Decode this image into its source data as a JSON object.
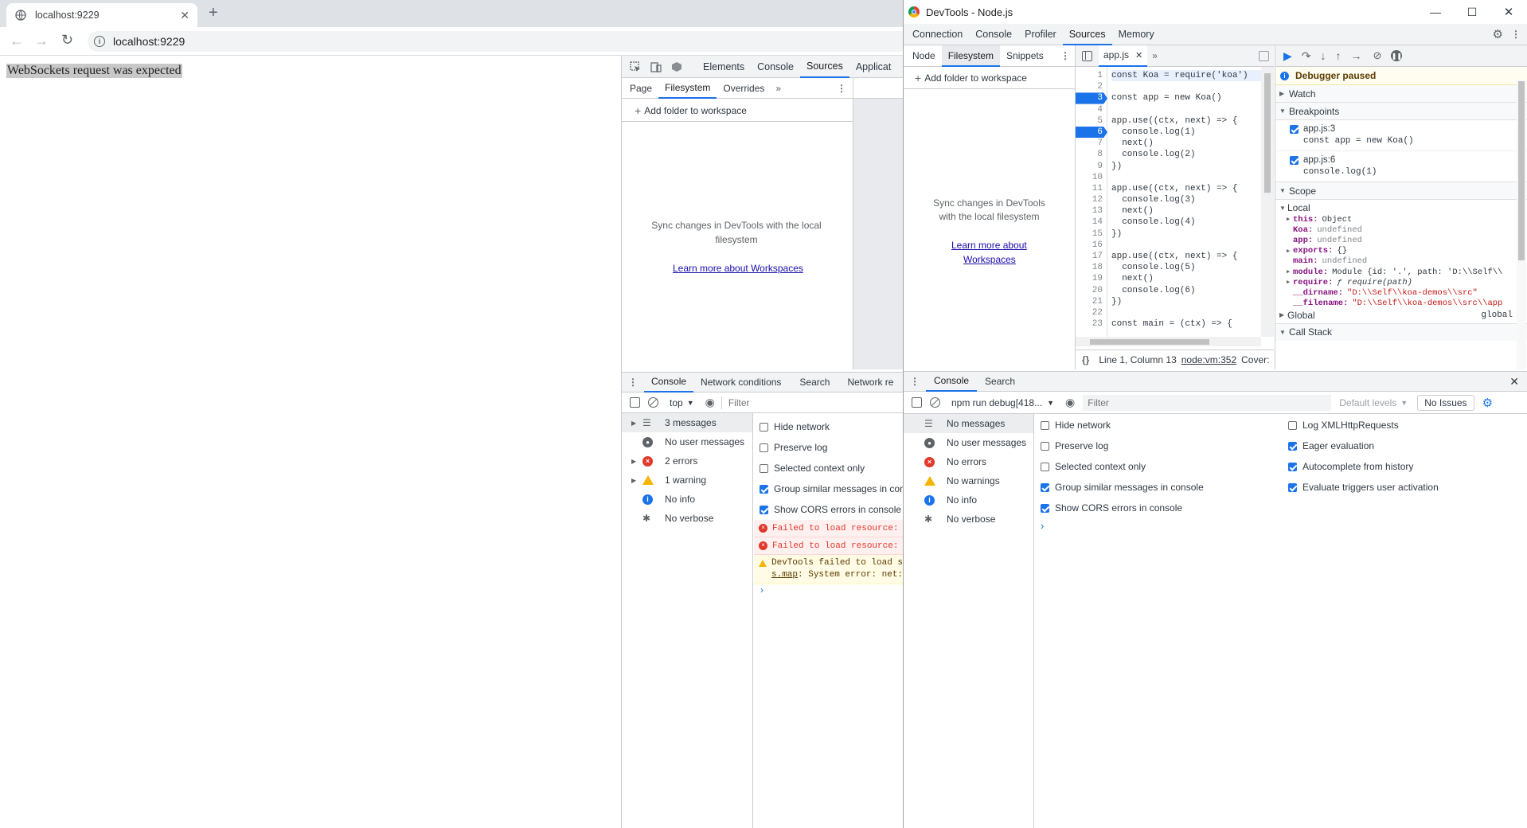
{
  "browser": {
    "tab_title": "localhost:9229",
    "url": "localhost:9229",
    "page_text": "WebSockets request was expected"
  },
  "inpage_devtools": {
    "main_tabs": [
      "Elements",
      "Console",
      "Sources",
      "Applicat"
    ],
    "nav_tabs": [
      "Page",
      "Filesystem",
      "Overrides"
    ],
    "add_folder": "Add folder to workspace",
    "sync_text": "Sync changes in DevTools with the local filesystem",
    "learn_more": "Learn more about Workspaces",
    "drawer_tabs": [
      "Console",
      "Network conditions",
      "Search",
      "Network re"
    ],
    "context": "top",
    "filter_placeholder": "Filter",
    "sidebar": [
      {
        "label": "3 messages",
        "icon": "list-icon",
        "arrow": true
      },
      {
        "label": "No user messages",
        "icon": "user-icon",
        "arrow": false
      },
      {
        "label": "2 errors",
        "icon": "error-icon",
        "arrow": true
      },
      {
        "label": "1 warning",
        "icon": "warning-icon",
        "arrow": true
      },
      {
        "label": "No info",
        "icon": "info-icon",
        "arrow": false
      },
      {
        "label": "No verbose",
        "icon": "verbose-icon",
        "arrow": false
      }
    ],
    "settings": [
      {
        "label": "Hide network",
        "checked": false
      },
      {
        "label": "Preserve log",
        "checked": false
      },
      {
        "label": "Selected context only",
        "checked": false
      },
      {
        "label": "Group similar messages in con",
        "checked": true
      },
      {
        "label": "Show CORS errors in console",
        "checked": true
      }
    ],
    "messages": [
      {
        "type": "error",
        "text": "Failed to load resource:"
      },
      {
        "type": "error",
        "text": "Failed to load resource:"
      },
      {
        "type": "warning",
        "text": "DevTools failed to load s",
        "text2_link": "s.map",
        "text2": ": System error: net:"
      }
    ]
  },
  "node_devtools": {
    "title": "DevTools - Node.js",
    "top_tabs": [
      "Connection",
      "Console",
      "Profiler",
      "Sources",
      "Memory"
    ],
    "nav_tabs": [
      "Node",
      "Filesystem",
      "Snippets"
    ],
    "add_folder": "Add folder to workspace",
    "sync_text_1": "Sync changes in DevTools",
    "sync_text_2": "with the local filesystem",
    "learn_more_1": "Learn more about",
    "learn_more_2": "Workspaces",
    "file_tab": "app.js",
    "code_lines": [
      "const Koa = require('koa')",
      "",
      "const app = new Koa()",
      "",
      "app.use((ctx, next) => {",
      "  console.log(1)",
      "  next()",
      "  console.log(2)",
      "})",
      "",
      "app.use((ctx, next) => {",
      "  console.log(3)",
      "  next()",
      "  console.log(4)",
      "})",
      "",
      "app.use((ctx, next) => {",
      "  console.log(5)",
      "  next()",
      "  console.log(6)",
      "})",
      "",
      "const main = (ctx) => {"
    ],
    "status_position": "Line 1, Column 13",
    "status_vm": "node:vm:352",
    "status_coverage": "Cover:",
    "paused_text": "Debugger paused",
    "sections": {
      "watch": "Watch",
      "breakpoints": "Breakpoints",
      "scope": "Scope",
      "local": "Local",
      "global": "Global",
      "global_value": "global",
      "call_stack": "Call Stack"
    },
    "breakpoints": [
      {
        "file": "app.js:3",
        "code": "const app = new Koa()"
      },
      {
        "file": "app.js:6",
        "code": "console.log(1)"
      }
    ],
    "scope_items": [
      {
        "key": "this",
        "value": "Object",
        "arrow": true,
        "value_color": "#303942"
      },
      {
        "key": "Koa",
        "value": "undefined",
        "arrow": false,
        "value_color": "#80868b"
      },
      {
        "key": "app",
        "value": "undefined",
        "arrow": false,
        "value_color": "#80868b"
      },
      {
        "key": "exports",
        "value": "{}",
        "arrow": true,
        "value_color": "#303942"
      },
      {
        "key": "main",
        "value": "undefined",
        "arrow": false,
        "value_color": "#80868b"
      },
      {
        "key": "module",
        "value": "Module {id: '.', path: 'D:\\\\Self\\\\",
        "arrow": true,
        "value_color": "#303942"
      },
      {
        "key": "require",
        "value": "ƒ require(path)",
        "arrow": true,
        "value_color": "#303942"
      },
      {
        "key": "__dirname",
        "value": "\"D:\\\\Self\\\\koa-demos\\\\src\"",
        "arrow": false,
        "value_color": "#c41a16"
      },
      {
        "key": "__filename",
        "value": "\"D:\\\\Self\\\\koa-demos\\\\src\\\\app",
        "arrow": false,
        "value_color": "#c41a16"
      }
    ],
    "drawer_tabs": [
      "Console",
      "Search"
    ],
    "context": "npm run debug[418...",
    "filter_placeholder": "Filter",
    "levels": "Default levels",
    "issues": "No Issues",
    "sidebar": [
      {
        "label": "No messages",
        "icon": "list-icon"
      },
      {
        "label": "No user messages",
        "icon": "user-icon"
      },
      {
        "label": "No errors",
        "icon": "error-icon"
      },
      {
        "label": "No warnings",
        "icon": "warning-icon"
      },
      {
        "label": "No info",
        "icon": "info-icon"
      },
      {
        "label": "No verbose",
        "icon": "verbose-icon"
      }
    ],
    "settings_left": [
      {
        "label": "Hide network",
        "checked": false
      },
      {
        "label": "Preserve log",
        "checked": false
      },
      {
        "label": "Selected context only",
        "checked": false
      },
      {
        "label": "Group similar messages in console",
        "checked": true
      },
      {
        "label": "Show CORS errors in console",
        "checked": true
      }
    ],
    "settings_right": [
      {
        "label": "Log XMLHttpRequests",
        "checked": false
      },
      {
        "label": "Eager evaluation",
        "checked": true
      },
      {
        "label": "Autocomplete from history",
        "checked": true
      },
      {
        "label": "Evaluate triggers user activation",
        "checked": true
      }
    ]
  }
}
